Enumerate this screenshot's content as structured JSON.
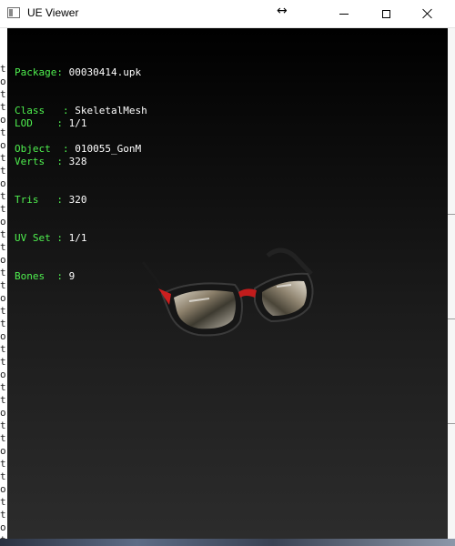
{
  "window": {
    "title": "UE Viewer",
    "controls": {
      "minimize": "minimize",
      "maximize": "maximize",
      "close": "close"
    }
  },
  "overlay": {
    "mesh_info": [
      {
        "key": "Package",
        "value": "00030414.upk"
      },
      {
        "key": "Class",
        "value": "SkeletalMesh"
      },
      {
        "key": "Object",
        "value": "010055_GonM"
      }
    ],
    "lod_info": [
      {
        "key": "LOD",
        "value": "1/1"
      },
      {
        "key": "Verts",
        "value": "328"
      },
      {
        "key": "Tris",
        "value": "320"
      },
      {
        "key": "UV Set",
        "value": "1/1"
      },
      {
        "key": "Bones",
        "value": "9"
      }
    ]
  },
  "background_terminal": {
    "visible_chars": [
      "t",
      "o",
      "t",
      "t",
      "o",
      "t",
      "o",
      "t",
      "t",
      "o",
      "t",
      "t",
      "o",
      "t",
      "t",
      "o",
      "t",
      "t",
      "o",
      "t",
      "t",
      "o",
      "t",
      "t",
      "o",
      "t",
      "t",
      "o",
      "t",
      "t",
      "o",
      "t",
      "t",
      "o",
      "t",
      "t",
      "o",
      "t"
    ]
  },
  "colors": {
    "info_key": "#4ff04f",
    "info_value": "#ffffff",
    "viewport_top": "#000000",
    "viewport_bottom": "#2c2c2c",
    "frame_accent": "#cc1f1f"
  }
}
